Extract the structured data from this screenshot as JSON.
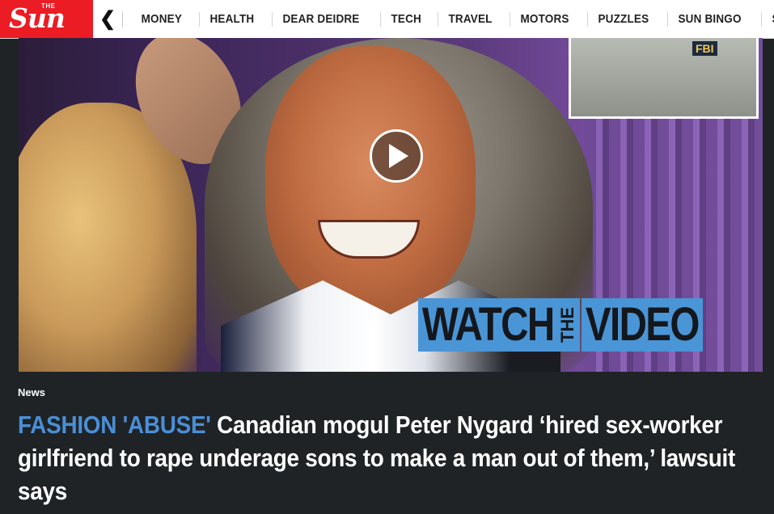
{
  "brand": {
    "logo_small": "THE",
    "logo_main": "Sun",
    "color": "#eb1c24"
  },
  "nav": {
    "back_icon": "chevron-left-icon",
    "items": [
      "MONEY",
      "HEALTH",
      "DEAR DEIDRE",
      "TECH",
      "TRAVEL",
      "MOTORS",
      "PUZZLES",
      "SUN BINGO",
      "SUN VOUCI"
    ]
  },
  "hero": {
    "inset_text": "FBI",
    "overlay_words": [
      "WATCH",
      "THE",
      "VIDEO"
    ],
    "overlay_color": "#4a95d6",
    "play_icon": "play-icon"
  },
  "article": {
    "kicker": "News",
    "flag": "FASHION 'ABUSE'",
    "flag_color": "#4a8fd6",
    "title": "Canadian mogul Peter Nygard ‘hired sex-worker girlfriend to rape underage sons to make a man out of them,’ lawsuit says"
  }
}
